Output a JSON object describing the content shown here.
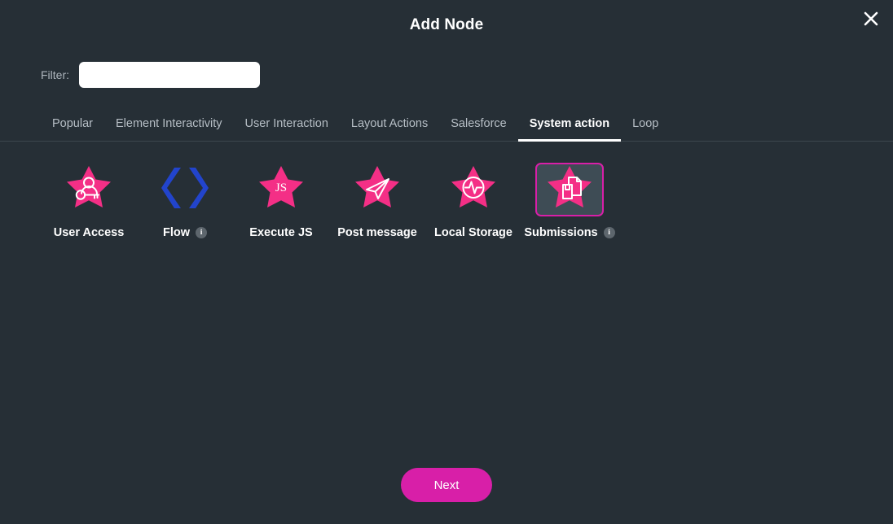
{
  "dialog": {
    "title": "Add Node",
    "close_icon": "close-icon"
  },
  "filter": {
    "label": "Filter:",
    "value": "",
    "placeholder": ""
  },
  "tabs": [
    {
      "label": "Popular",
      "active": false
    },
    {
      "label": "Element Interactivity",
      "active": false
    },
    {
      "label": "User Interaction",
      "active": false
    },
    {
      "label": "Layout Actions",
      "active": false
    },
    {
      "label": "Salesforce",
      "active": false
    },
    {
      "label": "System action",
      "active": true
    },
    {
      "label": "Loop",
      "active": false
    }
  ],
  "nodes": [
    {
      "label": "User Access",
      "icon": "user-key-star-icon",
      "selected": false,
      "info": false
    },
    {
      "label": "Flow",
      "icon": "angle-brackets-icon",
      "selected": false,
      "info": true
    },
    {
      "label": "Execute JS",
      "icon": "js-star-icon",
      "selected": false,
      "info": false
    },
    {
      "label": "Post message",
      "icon": "paper-plane-star-icon",
      "selected": false,
      "info": false
    },
    {
      "label": "Local Storage",
      "icon": "pulse-star-icon",
      "selected": false,
      "info": false
    },
    {
      "label": "Submissions",
      "icon": "document-star-icon",
      "selected": true,
      "info": true
    }
  ],
  "info_badge_glyph": "i",
  "footer": {
    "next_label": "Next"
  },
  "colors": {
    "background": "#262f36",
    "star_pink": "#f42f86",
    "accent_magenta": "#d81fa8",
    "flow_blue": "#2244cc",
    "tile_selected_bg": "#3e4c55",
    "tab_inactive": "#b6bec5"
  }
}
